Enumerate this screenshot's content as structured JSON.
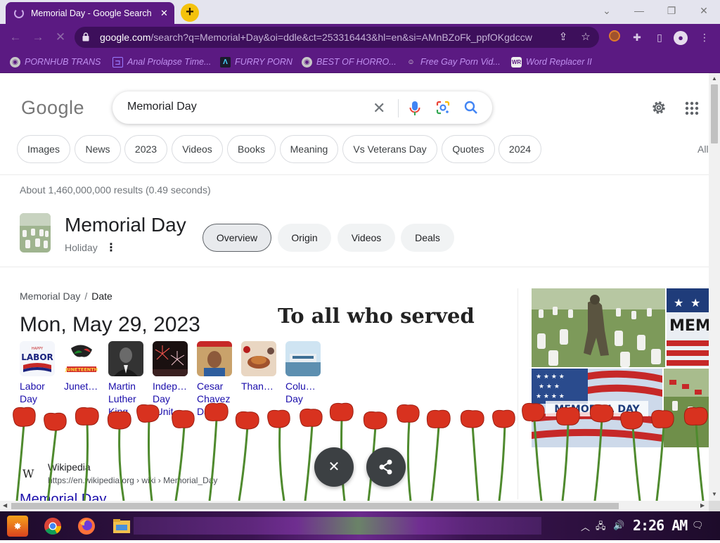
{
  "browser": {
    "tab_title": "Memorial Day - Google Search",
    "tab_close": "✕",
    "new_tab": "+",
    "window_minimize": "—",
    "window_restore": "❐",
    "window_close": "✕",
    "window_dropdown": "⌄",
    "url_host": "google.com",
    "url_rest": "/search?q=Memorial+Day&oi=ddle&ct=253316443&hl=en&si=AMnBZoFk_ppfOKgdccw...",
    "bookmarks": [
      {
        "label": "PORNHUB TRANS",
        "icon": "globe-icon",
        "color": "#c08ff0"
      },
      {
        "label": "Anal Prolapse Time...",
        "icon": "bookmark-icon",
        "color": "#c08ff0"
      },
      {
        "label": "FURRY PORN",
        "icon": "lambda-icon",
        "color": "#c08ff0"
      },
      {
        "label": "BEST OF HORRO...",
        "icon": "globe-icon",
        "color": "#c08ff0"
      },
      {
        "label": "Free Gay Porn Vid...",
        "icon": "ghost-icon",
        "color": "#c08ff0"
      },
      {
        "label": "Word Replacer II",
        "icon": "wr-icon",
        "color": "#c08ff0"
      }
    ]
  },
  "google": {
    "logo": "Google",
    "query": "Memorial Day",
    "chips": [
      "Images",
      "News",
      "2023",
      "Videos",
      "Books",
      "Meaning",
      "Vs Veterans Day",
      "Quotes",
      "2024"
    ],
    "chips_more": "All",
    "stats": "About 1,460,000,000 results (0.49 seconds)"
  },
  "knowledge_panel": {
    "title": "Memorial Day",
    "subtitle": "Holiday",
    "more_icon": "⋮",
    "tabs": [
      "Overview",
      "Origin",
      "Videos",
      "Deals"
    ]
  },
  "date_card": {
    "breadcrumb_parent": "Memorial Day",
    "breadcrumb_sep": "/",
    "breadcrumb_current": "Date",
    "date": "Mon, May 29, 2023",
    "holidays": [
      "Labor Day",
      "Junet…",
      "Martin Luther King",
      "Indep… Day (Unit…",
      "Cesar Chavez Da…",
      "Than…",
      "Colu… Day"
    ]
  },
  "overlay": {
    "text": "To all who served"
  },
  "wiki": {
    "icon": "W",
    "name": "Wikipedia",
    "url": "https://en.wikipedia.org › wiki › Memorial_Day",
    "title": "Memorial Day"
  },
  "image_banner_text": {
    "mem": "MEM",
    "memorial_day": "MEMORIAL DAY"
  },
  "fabs": {
    "close": "✕",
    "share": "share-icon"
  },
  "taskbar": {
    "clock": "2:26 AM",
    "tray_up": "︿"
  },
  "colors": {
    "chrome_purple": "#5b1a82",
    "omnibox_bg": "#3d0f5b",
    "link_blue": "#1a0dab",
    "poppy_red": "#d8321f"
  }
}
